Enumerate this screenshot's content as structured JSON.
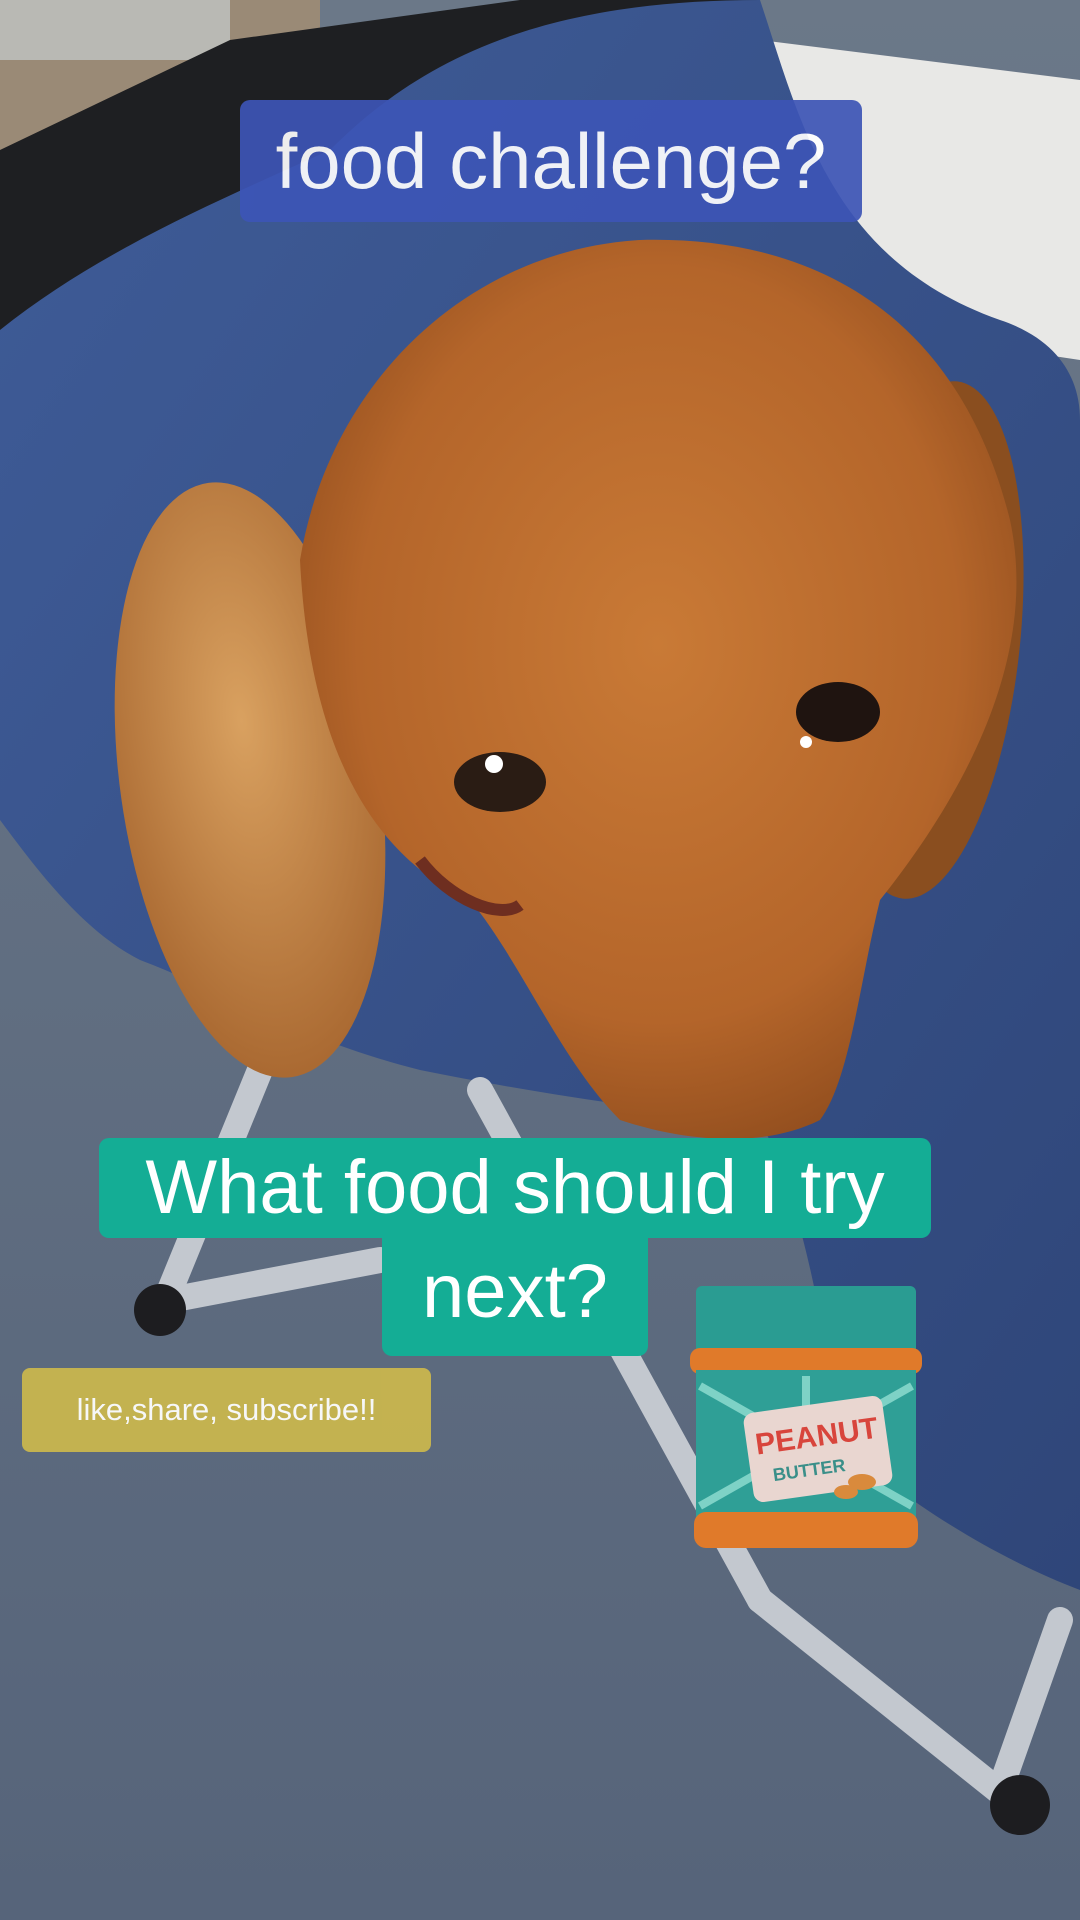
{
  "captions": {
    "top": "food challenge?",
    "question_line1": "What food should I try",
    "question_line2": "next?",
    "call_to_action": "like,share, subscribe!!"
  },
  "sticker": {
    "name": "peanut-butter-jar-icon",
    "label_line1": "PEANUT",
    "label_line2": "BUTTER"
  },
  "colors": {
    "top_caption_bg": "#3d55b6",
    "question_caption_bg": "#14ad95",
    "cta_caption_bg": "#c9b64e",
    "dog_fur": "#b8672a",
    "blanket": "#3b5591",
    "carpet": "#5d6b7c"
  }
}
